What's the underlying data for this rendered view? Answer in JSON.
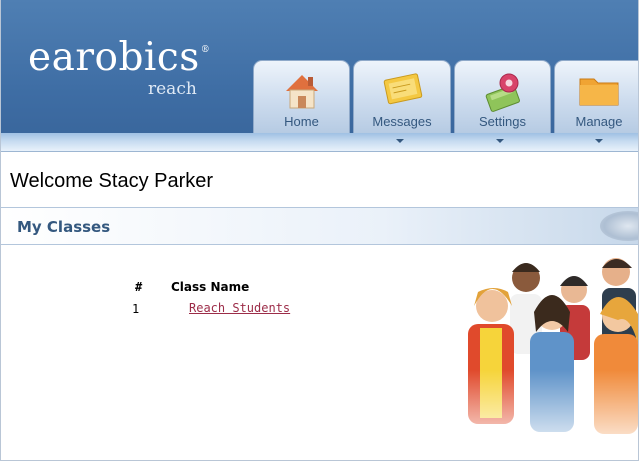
{
  "brand": {
    "name": "earobics",
    "registered": "®",
    "sub": "reach"
  },
  "tabs": [
    {
      "label": "Home",
      "icon": "home-icon"
    },
    {
      "label": "Messages",
      "icon": "messages-icon"
    },
    {
      "label": "Settings",
      "icon": "settings-icon"
    },
    {
      "label": "Manage",
      "icon": "manage-folder-icon"
    }
  ],
  "welcome": "Welcome Stacy Parker",
  "section": {
    "title": "My Classes"
  },
  "table": {
    "headers": [
      "#",
      "Class Name"
    ],
    "rows": [
      {
        "num": "1",
        "name": "Reach Students"
      }
    ]
  },
  "colors": {
    "header": "#3e6da4",
    "accent_text": "#34587f",
    "link": "#9c2c48"
  }
}
